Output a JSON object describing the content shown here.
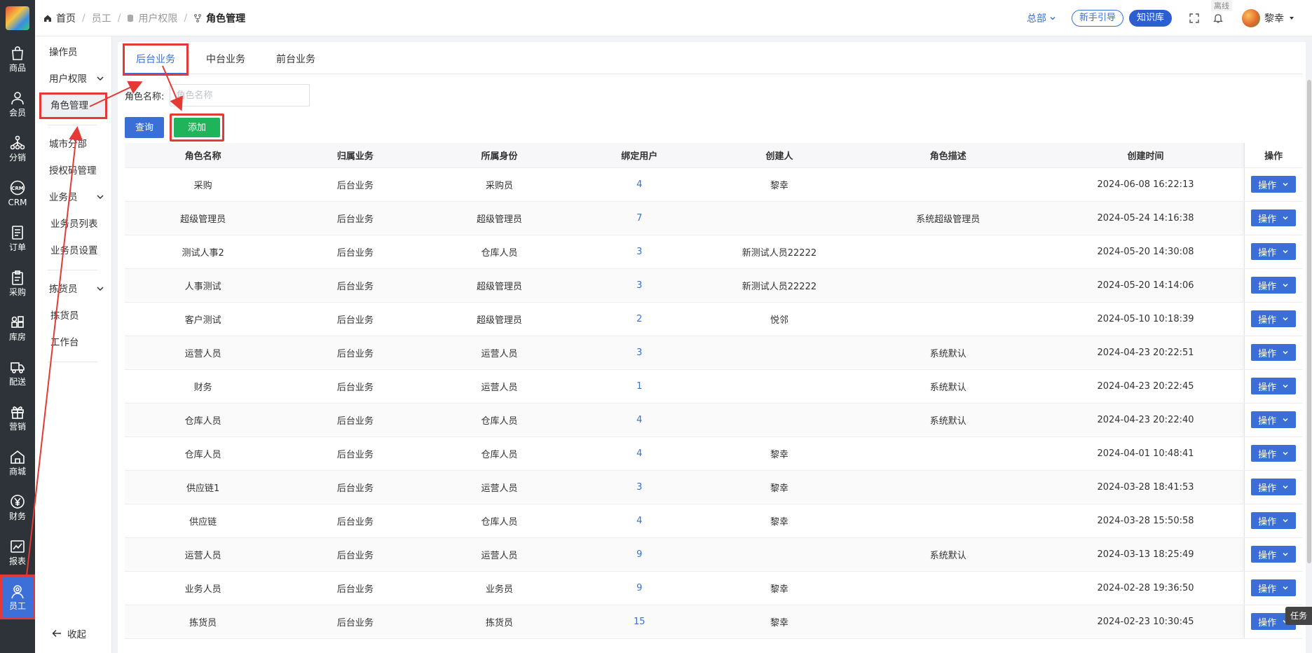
{
  "rail": [
    {
      "label": "商品",
      "icon": "bag-icon"
    },
    {
      "label": "会员",
      "icon": "user-icon"
    },
    {
      "label": "分销",
      "icon": "network-icon"
    },
    {
      "label": "CRM",
      "icon": "crm-icon"
    },
    {
      "label": "订单",
      "icon": "order-icon"
    },
    {
      "label": "采购",
      "icon": "clipboard-icon"
    },
    {
      "label": "库房",
      "icon": "grid-icon"
    },
    {
      "label": "配送",
      "icon": "truck-icon"
    },
    {
      "label": "营销",
      "icon": "gift-icon"
    },
    {
      "label": "商城",
      "icon": "home-icon"
    },
    {
      "label": "财务",
      "icon": "yen-icon"
    },
    {
      "label": "报表",
      "icon": "chart-icon"
    },
    {
      "label": "员工",
      "icon": "staff-icon",
      "active": true
    }
  ],
  "submenu": {
    "operator": "操作员",
    "user_perm": "用户权限",
    "role_mgmt": "角色管理",
    "city_branch": "城市分部",
    "auth_code": "授权码管理",
    "salesman": "业务员",
    "salesman_list": "业务员列表",
    "salesman_settings": "业务员设置",
    "picker": "拣货员",
    "picker_item": "拣货员",
    "workbench": "工作台",
    "collapse": "收起"
  },
  "breadcrumb": {
    "home": "首页",
    "staff": "员工",
    "user_perm": "用户权限",
    "current": "角色管理"
  },
  "header": {
    "hq": "总部",
    "guide": "新手引导",
    "knowledge": "知识库",
    "offline": "离线",
    "username": "黎幸"
  },
  "tabs": [
    "后台业务",
    "中台业务",
    "前台业务"
  ],
  "filter": {
    "label": "角色名称:",
    "placeholder": "角色名称",
    "value": ""
  },
  "buttons": {
    "query": "查询",
    "add": "添加"
  },
  "table": {
    "columns": [
      "角色名称",
      "归属业务",
      "所属身份",
      "绑定用户",
      "创建人",
      "角色描述",
      "创建时间",
      "操作"
    ],
    "op_label": "操作",
    "rows": [
      [
        "采购",
        "后台业务",
        "采购员",
        "4",
        "黎幸",
        "",
        "2024-06-08 16:22:13"
      ],
      [
        "超级管理员",
        "后台业务",
        "超级管理员",
        "7",
        "",
        "系统超级管理员",
        "2024-05-24 14:16:38"
      ],
      [
        "测试人事2",
        "后台业务",
        "仓库人员",
        "3",
        "新测试人员22222",
        "",
        "2024-05-20 14:30:08"
      ],
      [
        "人事测试",
        "后台业务",
        "超级管理员",
        "3",
        "新测试人员22222",
        "",
        "2024-05-20 14:14:06"
      ],
      [
        "客户测试",
        "后台业务",
        "超级管理员",
        "2",
        "悦邻",
        "",
        "2024-05-10 10:18:39"
      ],
      [
        "运营人员",
        "后台业务",
        "运营人员",
        "3",
        "",
        "系统默认",
        "2024-04-23 20:22:51"
      ],
      [
        "财务",
        "后台业务",
        "运营人员",
        "1",
        "",
        "系统默认",
        "2024-04-23 20:22:45"
      ],
      [
        "仓库人员",
        "后台业务",
        "仓库人员",
        "4",
        "",
        "系统默认",
        "2024-04-23 20:22:40"
      ],
      [
        "仓库人员",
        "后台业务",
        "仓库人员",
        "4",
        "黎幸",
        "",
        "2024-04-01 10:48:41"
      ],
      [
        "供应链1",
        "后台业务",
        "运营人员",
        "3",
        "黎幸",
        "",
        "2024-03-28 18:41:53"
      ],
      [
        "供应链",
        "后台业务",
        "仓库人员",
        "4",
        "黎幸",
        "",
        "2024-03-28 15:50:58"
      ],
      [
        "运营人员",
        "后台业务",
        "运营人员",
        "9",
        "",
        "系统默认",
        "2024-03-13 18:25:49"
      ],
      [
        "业务人员",
        "后台业务",
        "业务员",
        "9",
        "黎幸",
        "",
        "2024-02-28 19:36:50"
      ],
      [
        "拣货员",
        "后台业务",
        "拣货员",
        "15",
        "黎幸",
        "",
        "2024-02-23 10:30:45"
      ]
    ]
  },
  "task_tag": "任务",
  "colors": {
    "primary": "#3a6fd8",
    "add": "#1fb35a",
    "rail": "#2d3338",
    "annotation": "#e53935"
  }
}
